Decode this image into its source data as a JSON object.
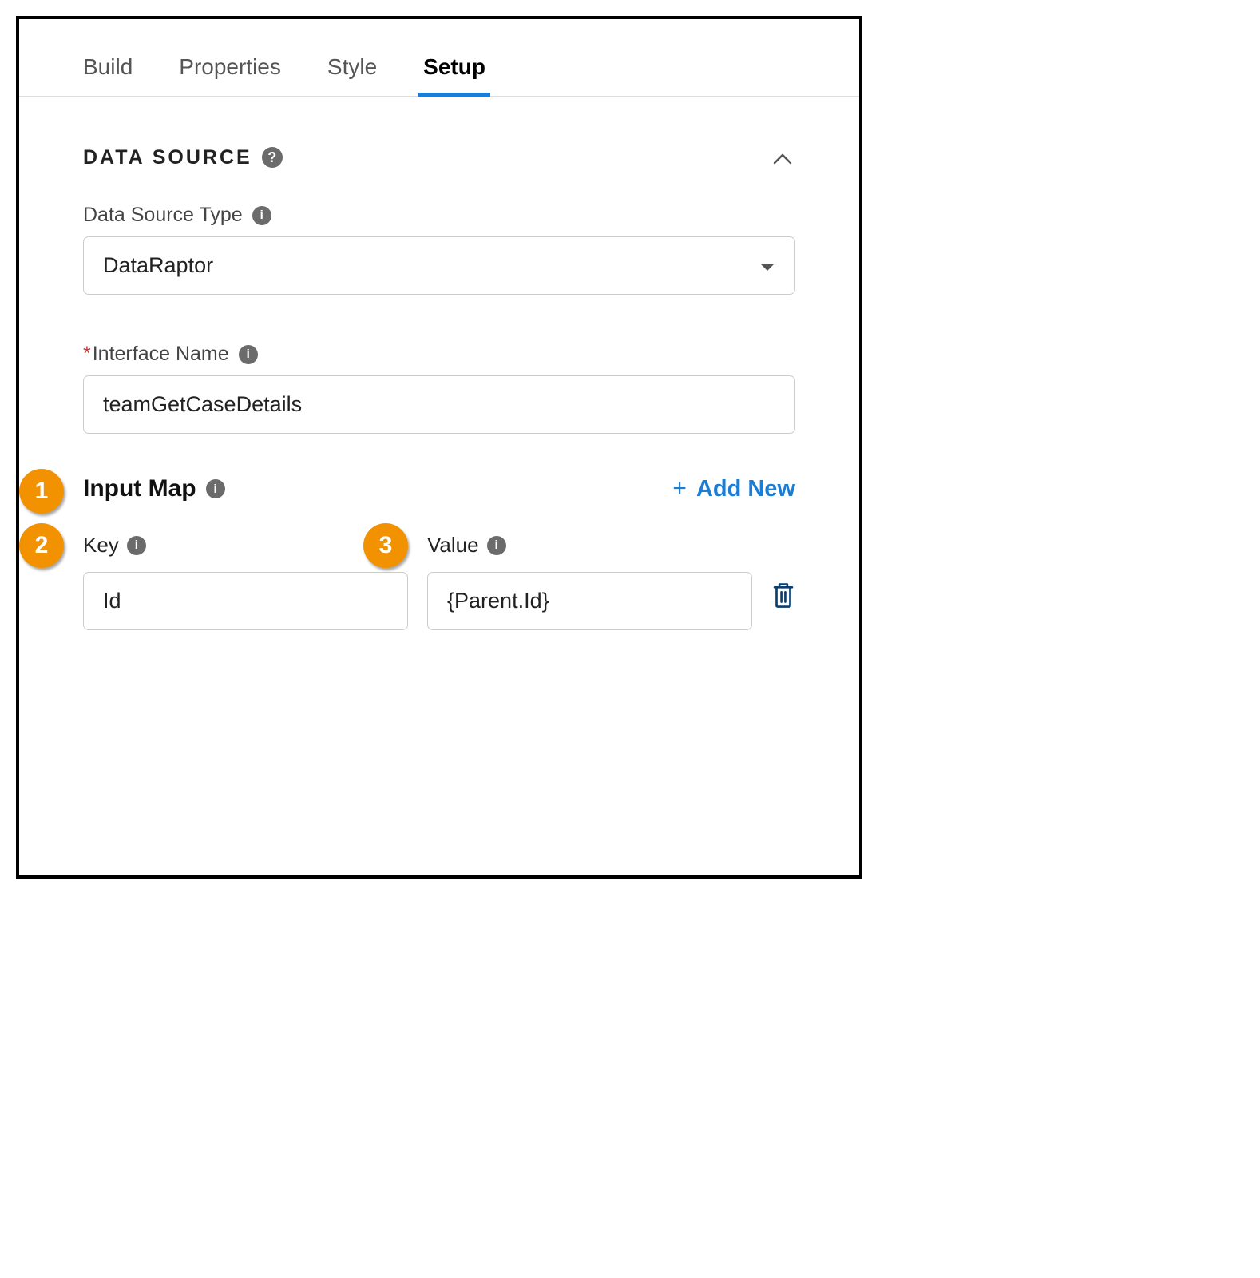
{
  "tabs": {
    "build": "Build",
    "properties": "Properties",
    "style": "Style",
    "setup": "Setup"
  },
  "section": {
    "title": "DATA SOURCE"
  },
  "dataSourceType": {
    "label": "Data Source Type",
    "value": "DataRaptor"
  },
  "interfaceName": {
    "label": "Interface Name",
    "value": "teamGetCaseDetails"
  },
  "inputMap": {
    "title": "Input Map",
    "addNew": "Add New",
    "keyLabel": "Key",
    "valueLabel": "Value",
    "rows": [
      {
        "key": "Id",
        "value": "{Parent.Id}"
      }
    ]
  },
  "callouts": {
    "one": "1",
    "two": "2",
    "three": "3"
  }
}
